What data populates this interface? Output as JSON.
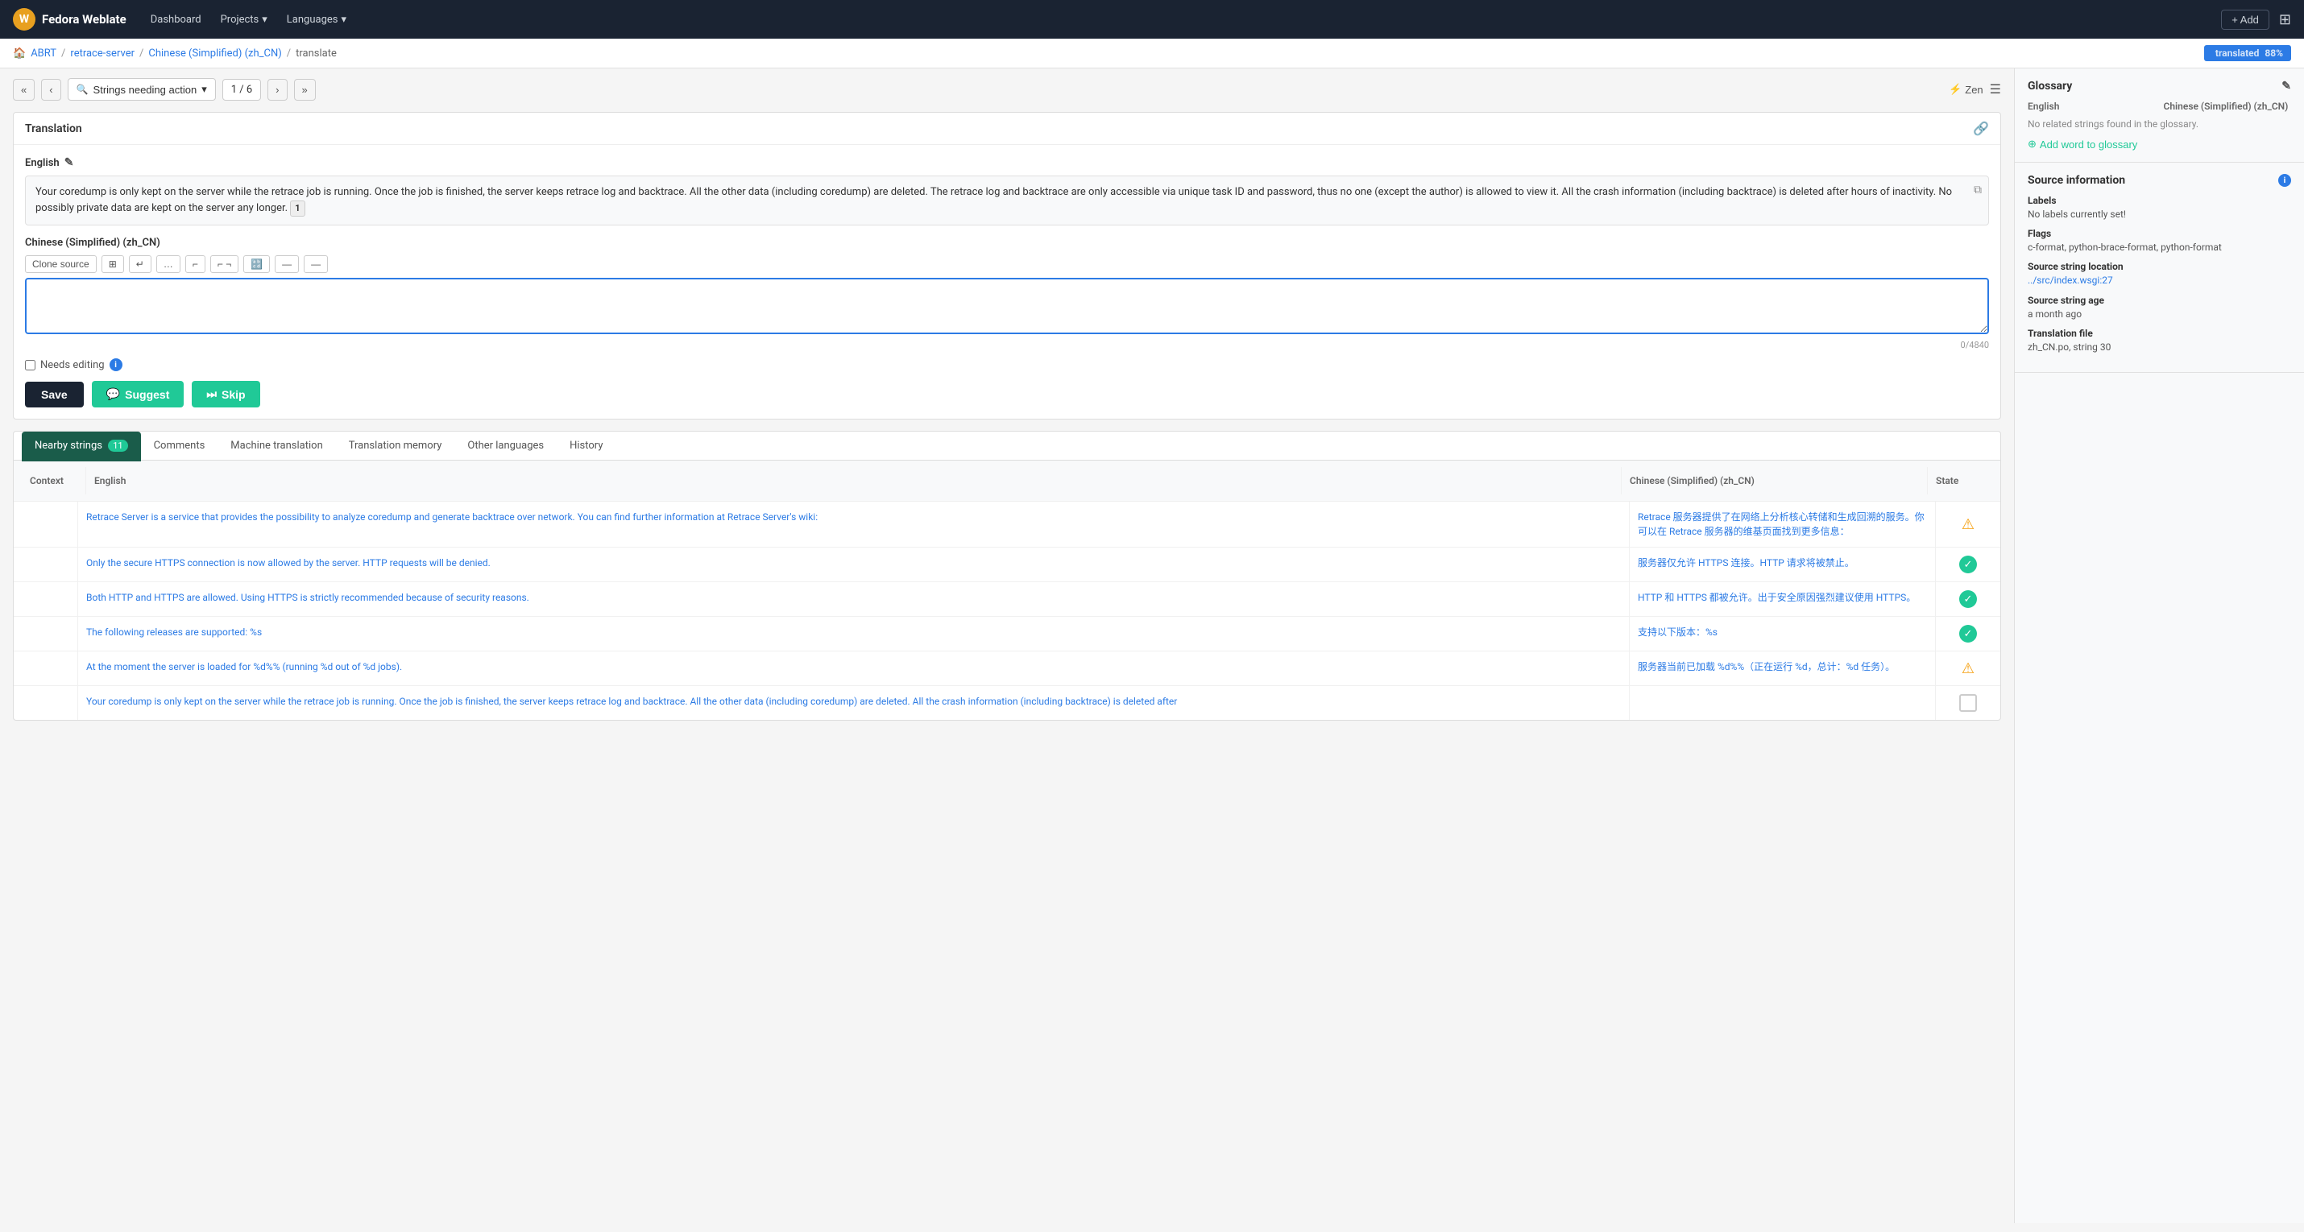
{
  "navbar": {
    "brand": "Fedora Weblate",
    "links": [
      "Dashboard",
      "Projects",
      "Languages"
    ],
    "add_label": "+ Add"
  },
  "breadcrumb": {
    "items": [
      "ABRT",
      "retrace-server",
      "Chinese (Simplified) (zh_CN)",
      "translate"
    ],
    "badge": "translated",
    "badge_pct": "88%"
  },
  "toolbar": {
    "first_label": "«",
    "prev_label": "‹",
    "filter_label": "Strings needing action",
    "page_label": "1 / 6",
    "next_label": "›",
    "last_label": "»",
    "zen_label": "Zen",
    "layout_label": "☰"
  },
  "translation_panel": {
    "title": "Translation",
    "english_label": "English",
    "source_text": "Your coredump is only kept on the server while the retrace job is running. Once the job is finished, the server keeps retrace log and backtrace. All the other data (including coredump) are deleted. The retrace log and backtrace are only accessible via unique task ID and password, thus no one (except the author) is allowed to view it. All the crash information (including backtrace) is deleted after  hours of inactivity. No possibly private data are kept on the server any longer.",
    "plural_marker": "1",
    "chinese_label": "Chinese (Simplified) (zh_CN)",
    "clone_source_label": "Clone source",
    "textarea_placeholder": "",
    "char_count": "0/4840",
    "needs_editing_label": "Needs editing",
    "save_label": "Save",
    "suggest_label": "Suggest",
    "skip_label": "Skip"
  },
  "tabs": [
    {
      "id": "nearby",
      "label": "Nearby strings",
      "badge": "11",
      "active": true
    },
    {
      "id": "comments",
      "label": "Comments",
      "badge": null,
      "active": false
    },
    {
      "id": "machine",
      "label": "Machine translation",
      "badge": null,
      "active": false
    },
    {
      "id": "memory",
      "label": "Translation memory",
      "badge": null,
      "active": false
    },
    {
      "id": "other",
      "label": "Other languages",
      "badge": null,
      "active": false
    },
    {
      "id": "history",
      "label": "History",
      "badge": null,
      "active": false
    }
  ],
  "nearby_table": {
    "headers": [
      "Context",
      "English",
      "Chinese (Simplified) (zh_CN)",
      "State"
    ],
    "rows": [
      {
        "context": "",
        "english": "Retrace Server is a service that provides the possibility to analyze coredump and generate backtrace over network. You can find further information at Retrace Server&apos;s wiki:",
        "chinese": "Retrace 服务器提供了在网络上分析核心转储和生成回溯的服务。你可以在 Retrace 服务器的维基页面找到更多信息：",
        "state": "warn"
      },
      {
        "context": "",
        "english": "Only the secure HTTPS connection is now allowed by the server. HTTP requests will be denied.",
        "chinese": "服务器仅允许 HTTPS 连接。HTTP 请求将被禁止。",
        "state": "ok"
      },
      {
        "context": "",
        "english": "Both HTTP and HTTPS are allowed. Using HTTPS is strictly recommended because of security reasons.",
        "chinese": "HTTP 和 HTTPS 都被允许。出于安全原因强烈建议使用 HTTPS。",
        "state": "ok"
      },
      {
        "context": "",
        "english": "The following releases are supported: %s",
        "chinese": "支持以下版本：%s",
        "state": "ok"
      },
      {
        "context": "",
        "english": "At the moment the server is loaded for %d%% (running %d out of %d jobs).",
        "chinese": "服务器当前已加载 %d%%（正在运行 %d，总计：%d 任务）。",
        "state": "warn"
      },
      {
        "context": "",
        "english": "Your coredump is only kept on the server while the retrace job is running. Once the job is finished, the server keeps retrace log and backtrace. All the other data (including coredump) are deleted. All the crash information (including backtrace) is deleted after",
        "chinese": "",
        "state": "empty"
      }
    ]
  },
  "glossary": {
    "title": "Glossary",
    "col_english": "English",
    "col_chinese": "Chinese (Simplified) (zh_CN)",
    "no_related": "No related strings found in the glossary.",
    "add_label": "Add word to glossary",
    "edit_icon": "✎"
  },
  "source_info": {
    "title": "Source information",
    "labels_label": "Labels",
    "labels_value": "No labels currently set!",
    "flags_label": "Flags",
    "flags_value": "c-format, python-brace-format, python-format",
    "location_label": "Source string location",
    "location_value": "../src/index.wsgi:27",
    "age_label": "Source string age",
    "age_value": "a month ago",
    "file_label": "Translation file",
    "file_value": "zh_CN.po, string 30"
  }
}
